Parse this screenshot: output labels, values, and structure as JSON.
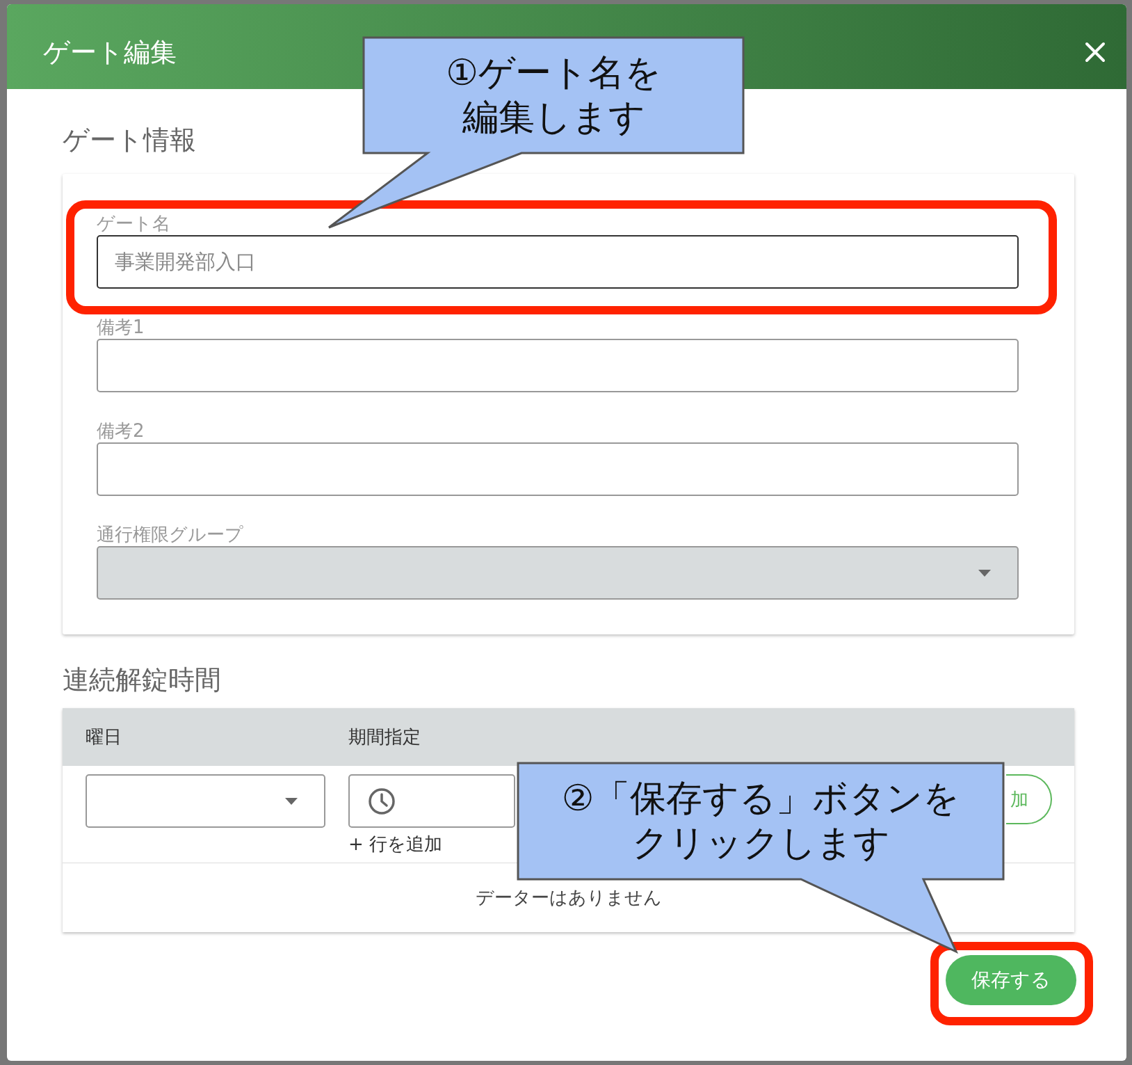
{
  "dialog": {
    "title": "ゲート編集"
  },
  "gate_info": {
    "heading": "ゲート情報",
    "fields": [
      {
        "label": "ゲート名",
        "kind": "text",
        "value": "事業開発部入口"
      },
      {
        "label": "備考1",
        "kind": "text"
      },
      {
        "label": "備考2",
        "kind": "text"
      },
      {
        "label": "通行権限グループ",
        "kind": "select",
        "disabled": true
      }
    ]
  },
  "unlock_times": {
    "heading": "連続解錠時間",
    "columns": [
      "曜日",
      "期間指定"
    ],
    "add_row_link": "+ 行を追加",
    "add_button_visible_text": "加",
    "empty_message": "データーはありません"
  },
  "save_button": "保存する",
  "annotations": [
    {
      "lines": [
        "①ゲート名を",
        "編集します"
      ]
    },
    {
      "lines": [
        "②「保存する」ボタンを",
        "クリックします"
      ]
    }
  ]
}
